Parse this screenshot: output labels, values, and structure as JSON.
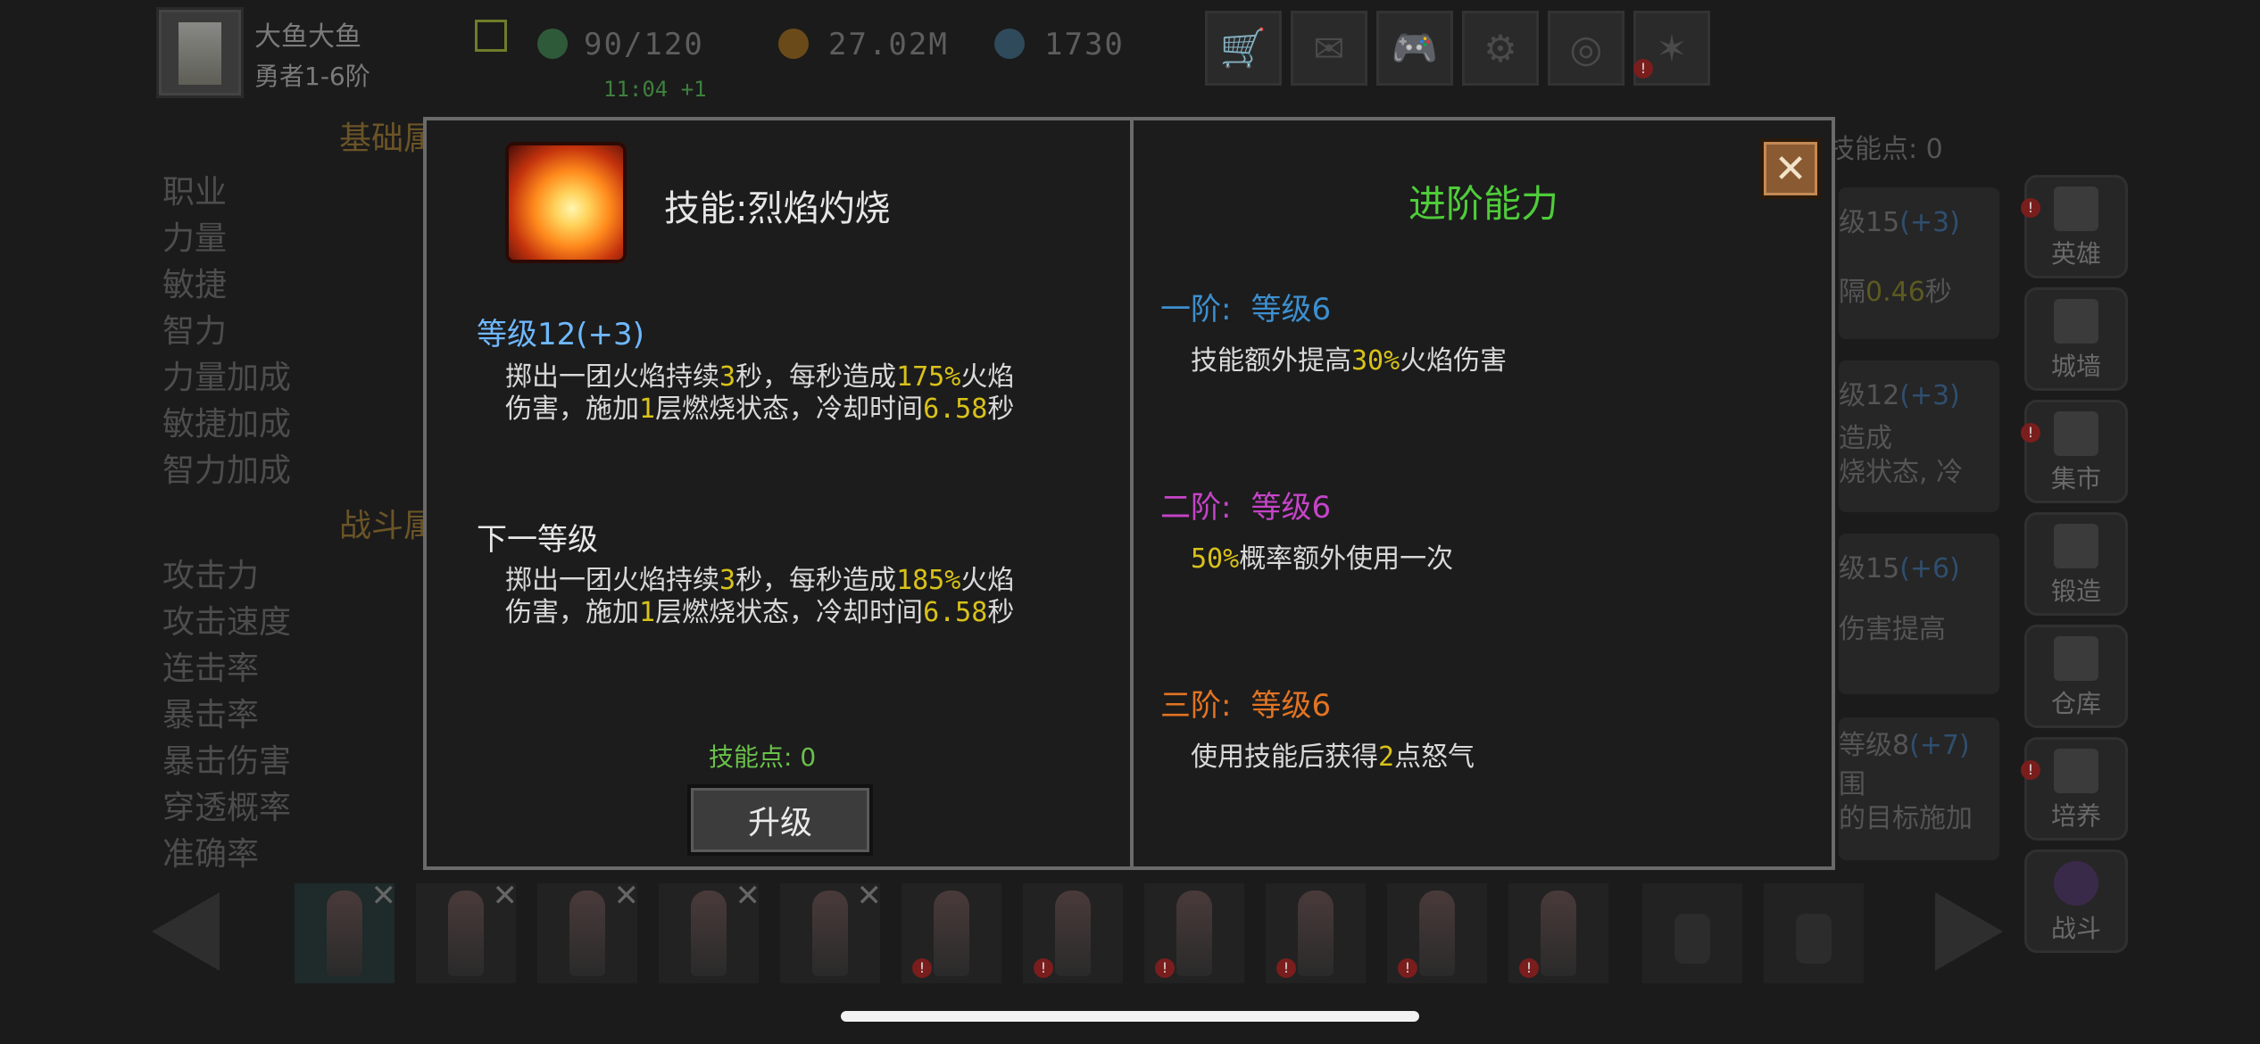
{
  "player": {
    "name": "大鱼大鱼",
    "rank": "勇者1-6阶"
  },
  "stats": {
    "energy": "90/120",
    "gold": "27.02M",
    "gems": "1730",
    "timer": "11:04 +1"
  },
  "top_buttons": [
    "cart-icon",
    "mail-icon",
    "gamepad-icon",
    "gear-icon",
    "colors-icon",
    "news-icon"
  ],
  "left": {
    "section1": "基础属",
    "section2": "战斗属",
    "attrs1": [
      "职业",
      "力量",
      "敏捷",
      "智力",
      "力量加成",
      "敏捷加成",
      "智力加成"
    ],
    "attrs2": [
      "攻击力",
      "攻击速度",
      "连击率",
      "暴击率",
      "暴击伤害",
      "穿透概率",
      "准确率"
    ]
  },
  "bg_right": {
    "skill_points": "技能点: 0",
    "card1": {
      "level": "级15",
      "bonus": "(+3)",
      "line": "隔",
      "value": "0.46",
      "unit": "秒"
    },
    "card2": {
      "level": "级12",
      "bonus": "(+3)",
      "line1": "造成",
      "line2": "烧状态, 冷"
    },
    "card3": {
      "level": "级15",
      "bonus": "(+6)",
      "line1": "伤害提高"
    },
    "card4": {
      "level": "等级8",
      "bonus": "(+7)",
      "line1": "围",
      "line2": "的目标施加"
    }
  },
  "sidebar": [
    "英雄",
    "城墙",
    "集市",
    "锻造",
    "仓库",
    "培养",
    "战斗"
  ],
  "modal": {
    "skill_title": "技能:烈焰灼烧",
    "level_label": "等级12(+3)",
    "cur": {
      "p1": "掷出一团火焰持续",
      "n1": "3",
      "p2": "秒，每秒造成",
      "n2": "175%",
      "p3": "火焰",
      "p4": "伤害，施加",
      "n3": "1",
      "p5": "层燃烧状态，冷却时间",
      "n4": "6.58",
      "p6": "秒"
    },
    "next_label": "下一等级",
    "next": {
      "p1": "掷出一团火焰持续",
      "n1": "3",
      "p2": "秒，每秒造成",
      "n2": "185%",
      "p3": "火焰",
      "p4": "伤害，施加",
      "n3": "1",
      "p5": "层燃烧状态，冷却时间",
      "n4": "6.58",
      "p6": "秒"
    },
    "skill_points": "技能点: 0",
    "upgrade": "升级",
    "adv_title": "进阶能力",
    "tiers": [
      {
        "name": "一阶:",
        "level": "等级6",
        "pre": "技能额外提高",
        "num": "30%",
        "post": "火焰伤害",
        "color": "#3c8fd0"
      },
      {
        "name": "二阶:",
        "level": "等级6",
        "pre": "",
        "num": "50%",
        "post": "概率额外使用一次",
        "color": "#c544c8"
      },
      {
        "name": "三阶:",
        "level": "等级6",
        "pre": "使用技能后获得",
        "num": "2",
        "post": "点怒气",
        "color": "#e27423"
      }
    ]
  }
}
